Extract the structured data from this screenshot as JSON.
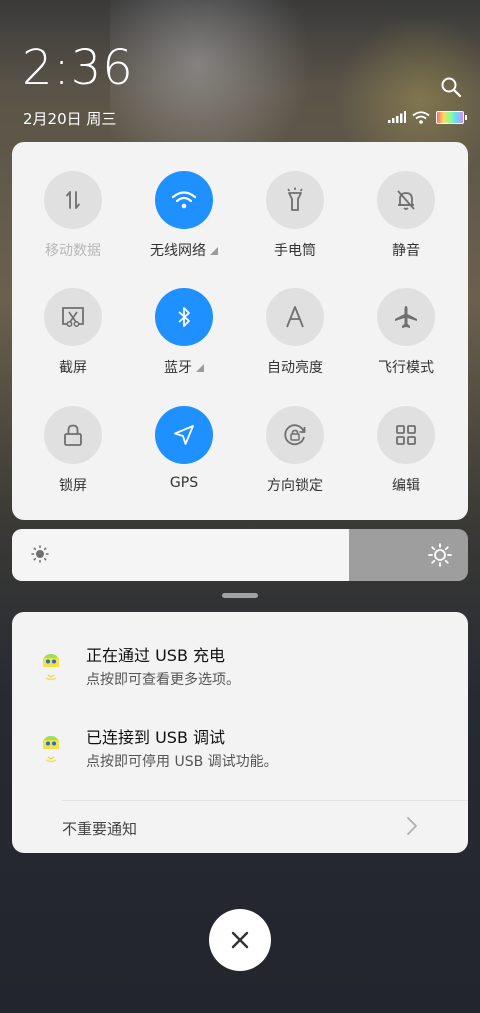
{
  "status": {
    "time": "2:36",
    "date": "2月20日 周三"
  },
  "quick_settings": {
    "tiles": [
      {
        "label": "移动数据",
        "icon": "mobile-data-icon",
        "state": "off"
      },
      {
        "label": "无线网络",
        "icon": "wifi-icon",
        "state": "on"
      },
      {
        "label": "手电筒",
        "icon": "flashlight-icon",
        "state": "off"
      },
      {
        "label": "静音",
        "icon": "mute-bell-icon",
        "state": "off"
      },
      {
        "label": "截屏",
        "icon": "screenshot-icon",
        "state": "off"
      },
      {
        "label": "蓝牙",
        "icon": "bluetooth-icon",
        "state": "on"
      },
      {
        "label": "自动亮度",
        "icon": "auto-brightness-icon",
        "state": "off"
      },
      {
        "label": "飞行模式",
        "icon": "airplane-icon",
        "state": "off"
      },
      {
        "label": "锁屏",
        "icon": "lock-icon",
        "state": "off"
      },
      {
        "label": "GPS",
        "icon": "gps-icon",
        "state": "on"
      },
      {
        "label": "方向锁定",
        "icon": "rotation-lock-icon",
        "state": "off"
      },
      {
        "label": "编辑",
        "icon": "edit-grid-icon",
        "state": "off"
      }
    ],
    "accent_color": "#1E90FF"
  },
  "brightness": {
    "level": 0.74
  },
  "notifications": {
    "items": [
      {
        "title": "正在通过 USB 充电",
        "subtitle": "点按即可查看更多选项。",
        "icon": "android-debug-icon"
      },
      {
        "title": "已连接到 USB 调试",
        "subtitle": "点按即可停用 USB 调试功能。",
        "icon": "android-debug-icon"
      }
    ],
    "unimportant_label": "不重要通知"
  },
  "dismiss": {
    "icon": "close-icon"
  }
}
